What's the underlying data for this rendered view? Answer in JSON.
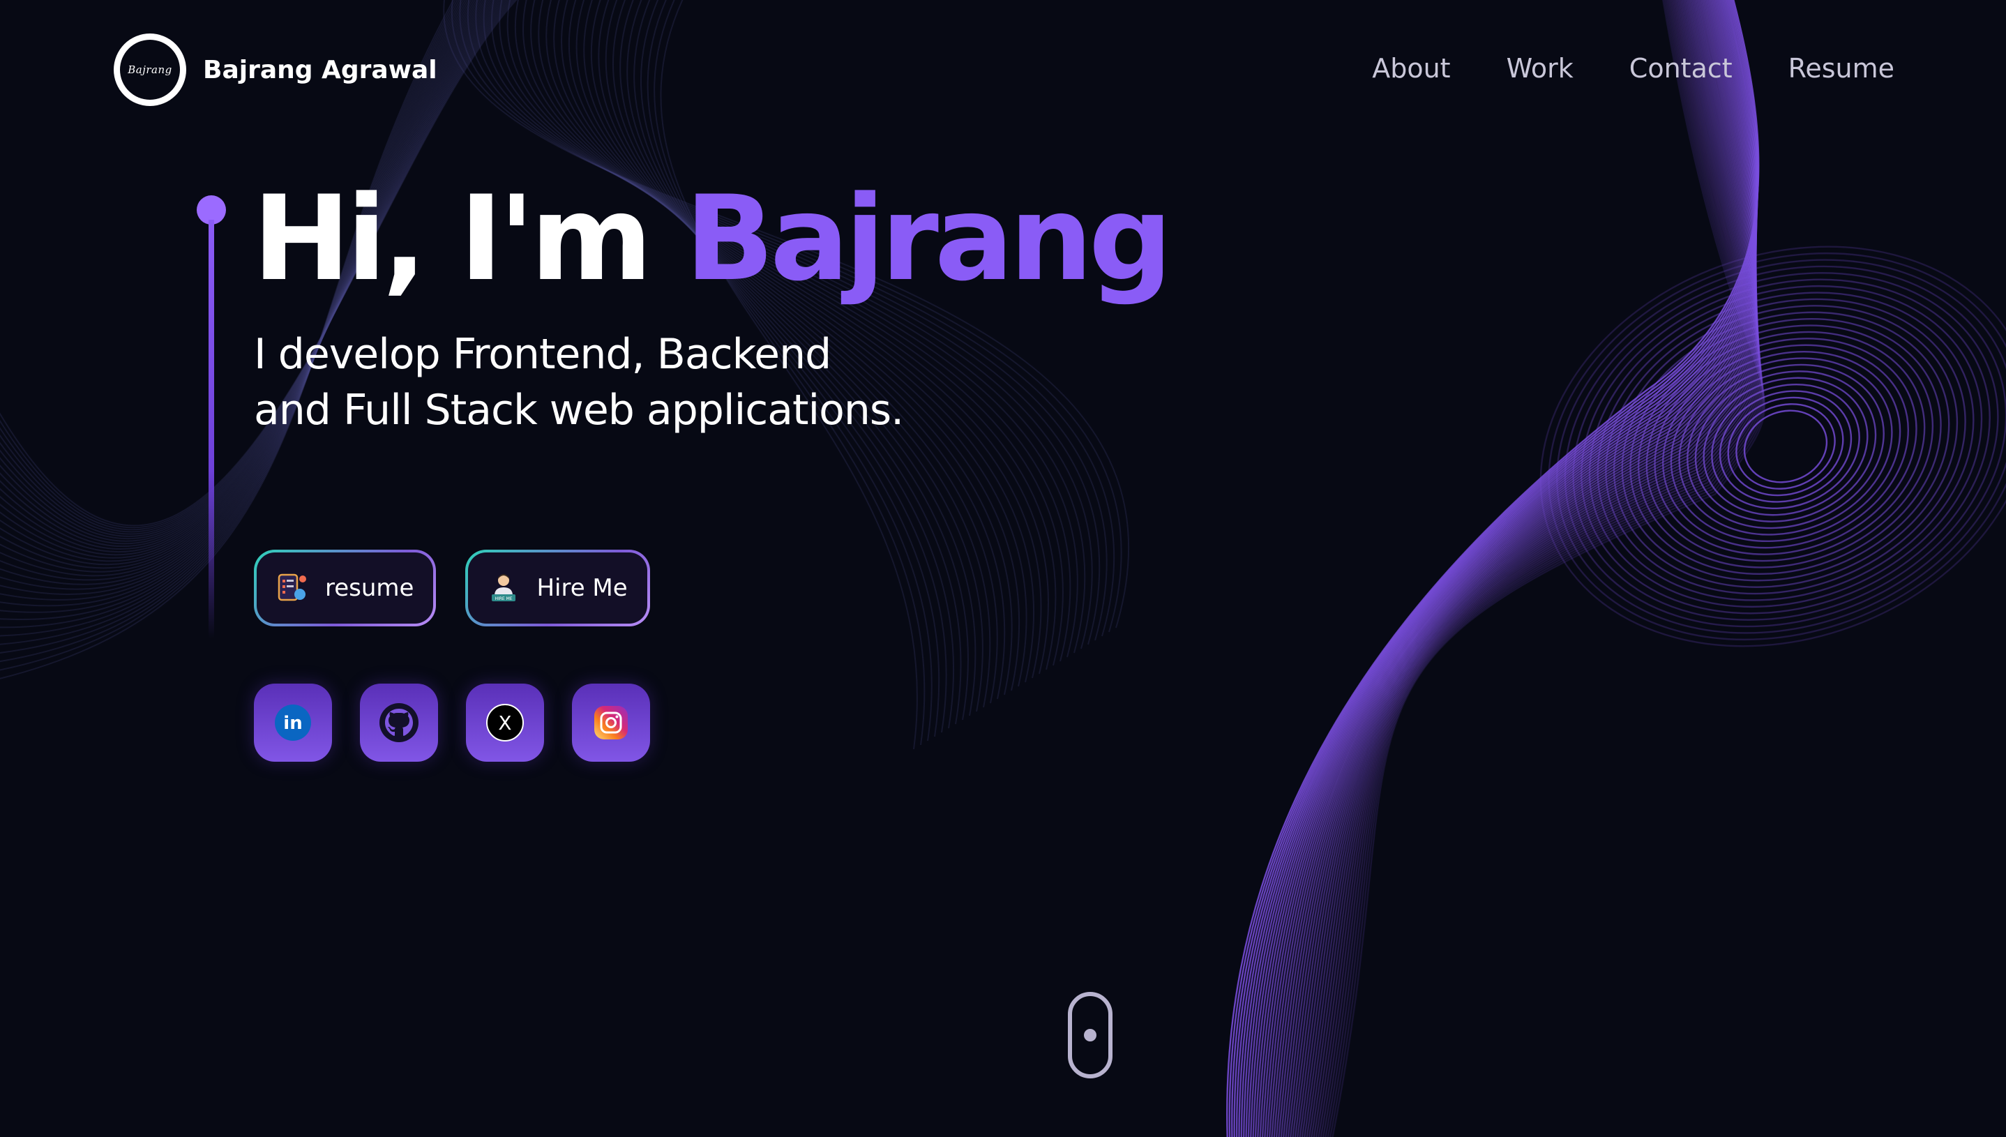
{
  "brand": {
    "logo_text": "Bajrang",
    "name": "Bajrang  Agrawal"
  },
  "nav": {
    "items": [
      "About",
      "Work",
      "Contact",
      "Resume"
    ]
  },
  "hero": {
    "greeting": "Hi, I'm",
    "name": "Bajrang",
    "subtitle_line1": "I develop Frontend, Backend",
    "subtitle_line2": "and Full Stack web applications."
  },
  "cta": {
    "resume_label": "resume",
    "hire_label": "Hire Me",
    "hire_badge": "HIRE ME"
  },
  "social": [
    {
      "name": "linkedin",
      "icon": "linkedin-icon",
      "text": "in"
    },
    {
      "name": "github",
      "icon": "github-icon"
    },
    {
      "name": "x",
      "icon": "x-icon",
      "text": "X"
    },
    {
      "name": "instagram",
      "icon": "instagram-icon"
    }
  ],
  "colors": {
    "background": "#070914",
    "accent": "#8a5cf6",
    "nav_text": "#c9c7d9",
    "button_border_start": "#2fd3b9",
    "button_border_end": "#b98ef6",
    "social_bg": "#6a40d0"
  }
}
